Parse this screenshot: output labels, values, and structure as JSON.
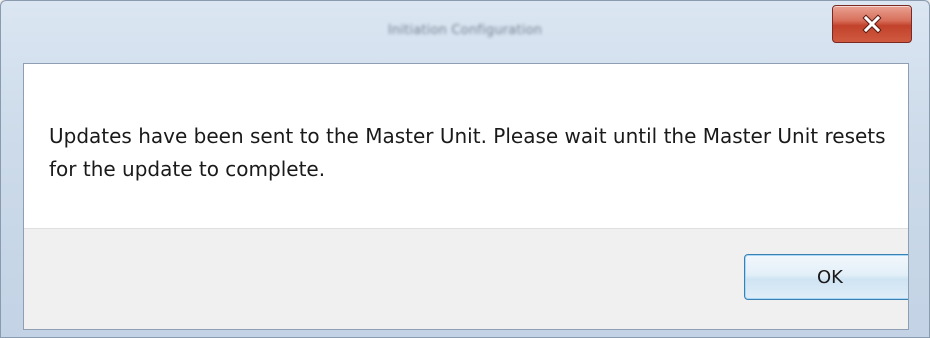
{
  "window": {
    "title": "Initiation Configuration"
  },
  "titlebar": {
    "close_icon": "close-icon",
    "close_color": "#c7432c"
  },
  "message": {
    "text": "Updates have been sent to the Master Unit.  Please wait until the Master Unit resets for the update to complete."
  },
  "buttons": {
    "ok_label": "OK"
  }
}
